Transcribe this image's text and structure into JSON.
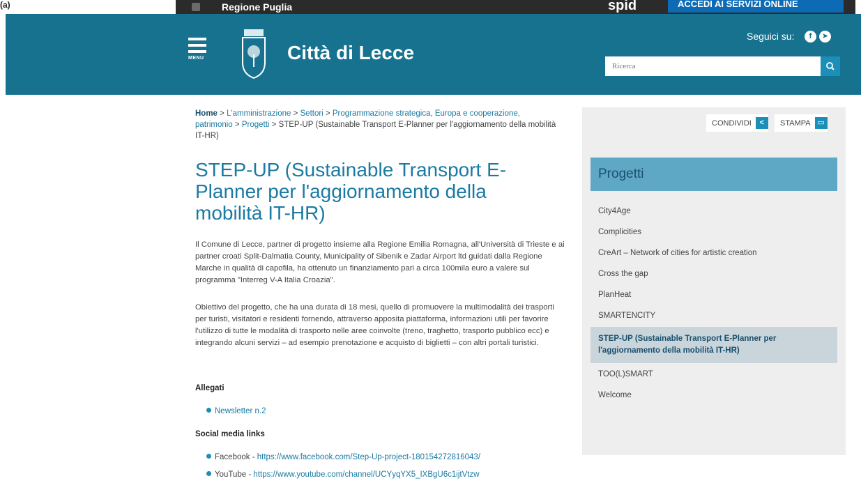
{
  "topbar": {
    "corner_label": "(a)",
    "region": "Regione Puglia",
    "spid": "spid",
    "access": "ACCEDI AI SERVIZI ONLINE"
  },
  "header": {
    "menu_label": "MENU",
    "site_title": "Città di Lecce",
    "follow_label": "Seguici su:",
    "search_placeholder": "Ricerca",
    "brand_color": "#17728f"
  },
  "breadcrumb": {
    "home": "Home",
    "sep": " > ",
    "items": [
      "L'amministrazione",
      "Settori",
      "Programmazione strategica, Europa e cooperazione, patrimonio",
      "Progetti"
    ],
    "current": "STEP-UP (Sustainable Transport E-Planner per l'aggiornamento della mobilità IT-HR)"
  },
  "main": {
    "title": "STEP-UP (Sustainable Transport E-Planner per l'aggiornamento della mobilità IT-HR)",
    "paragraph1": "Il Comune di Lecce, partner di progetto insieme alla Regione Emilia Romagna, all'Università di Trieste e ai partner croati Split-Dalmatia County, Municipality of Sibenik e Zadar Airport ltd guidati dalla Regione Marche in qualità di capofila, ha ottenuto un finanziamento pari a circa 100mila euro a valere sul programma \"Interreg V-A Italia Croazia\".",
    "paragraph2": "Obiettivo del progetto, che ha una durata di 18 mesi, quello di promuovere la multimodalità dei trasporti per turisti, visitatori e residenti fornendo, attraverso apposita piattaforma, informazioni utili per favorire l'utilizzo di tutte le modalità di trasporto nelle aree coinvolte (treno, traghetto, trasporto pubblico ecc) e integrando alcuni servizi – ad esempio prenotazione e acquisto di biglietti – con altri portali turistici.",
    "attachments_title": "Allegati",
    "newsletter": "Newsletter n.2",
    "social_title": "Social media links",
    "facebook_label": "Facebook - ",
    "facebook_url": "https://www.facebook.com/Step-Up-project-180154272816043/",
    "youtube_label": "YouTube - ",
    "youtube_url": "https://www.youtube.com/channel/UCYyqYX5_IXBgU6c1ijtVtzw"
  },
  "sidebar": {
    "share": "CONDIVIDI",
    "print": "STAMPA",
    "heading": "Progetti",
    "items": [
      "City4Age",
      "Complicities",
      "CreArt – Network of cities for artistic creation",
      "Cross the gap",
      "PlanHeat",
      "SMARTENCITY",
      "STEP-UP (Sustainable Transport E-Planner per l'aggiornamento della mobilità IT-HR)",
      "TOO(L)SMART",
      "Welcome"
    ],
    "active_index": 6
  }
}
